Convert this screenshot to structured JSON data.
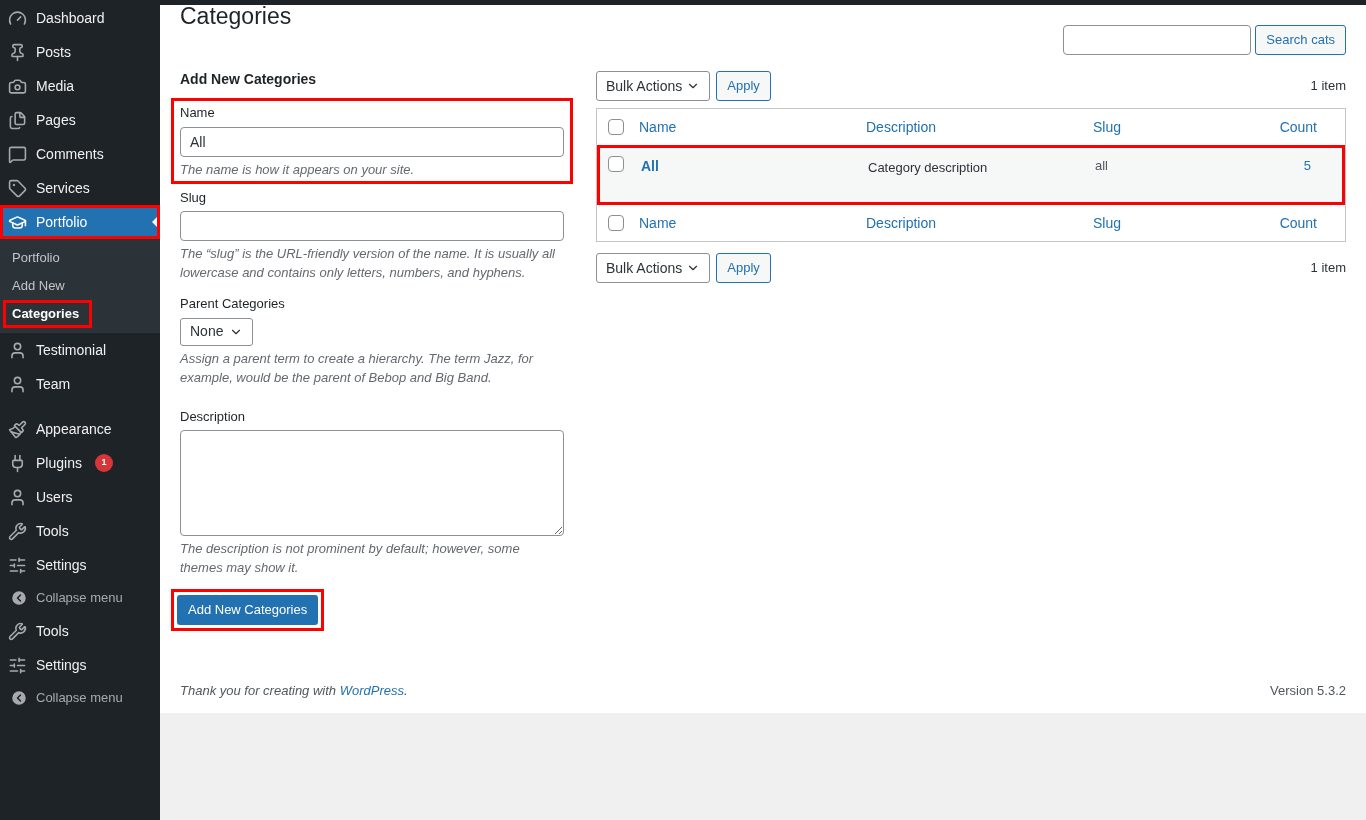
{
  "sidebar": {
    "items": [
      {
        "label": "Dashboard",
        "kind": "menu",
        "selected": false,
        "highlighted": false
      },
      {
        "label": "Posts",
        "kind": "menu",
        "selected": false,
        "highlighted": false
      },
      {
        "label": "Media",
        "kind": "menu",
        "selected": false,
        "highlighted": false
      },
      {
        "label": "Pages",
        "kind": "menu",
        "selected": false,
        "highlighted": false
      },
      {
        "label": "Comments",
        "kind": "menu",
        "selected": false,
        "highlighted": false
      },
      {
        "label": "Services",
        "kind": "menu",
        "selected": false,
        "highlighted": false
      },
      {
        "label": "Portfolio",
        "kind": "menu",
        "selected": true,
        "highlighted": true,
        "children": [
          {
            "label": "Portfolio",
            "selected": false,
            "highlighted": false
          },
          {
            "label": "Add New",
            "selected": false,
            "highlighted": false
          },
          {
            "label": "Categories",
            "selected": true,
            "highlighted": true
          }
        ]
      },
      {
        "label": "Testimonial",
        "kind": "menu",
        "selected": false,
        "highlighted": false
      },
      {
        "label": "Team",
        "kind": "menu",
        "selected": false,
        "highlighted": false
      },
      {
        "label": "Appearance",
        "kind": "menu",
        "selected": false,
        "highlighted": false
      },
      {
        "label": "Plugins",
        "kind": "menu",
        "selected": false,
        "highlighted": false,
        "badge": "1"
      },
      {
        "label": "Users",
        "kind": "menu",
        "selected": false,
        "highlighted": false
      },
      {
        "label": "Tools",
        "kind": "menu",
        "selected": false,
        "highlighted": false
      },
      {
        "label": "Settings",
        "kind": "menu",
        "selected": false,
        "highlighted": false
      },
      {
        "label": "Collapse menu",
        "kind": "collapse",
        "selected": false,
        "highlighted": false
      },
      {
        "label": "Tools",
        "kind": "menu",
        "selected": false,
        "highlighted": false
      },
      {
        "label": "Settings",
        "kind": "menu",
        "selected": false,
        "highlighted": false
      },
      {
        "label": "Collapse menu",
        "kind": "collapse",
        "selected": false,
        "highlighted": false
      }
    ]
  },
  "page_title": "Categories",
  "form": {
    "heading": "Add New Categories",
    "fields": [
      {
        "kind": "text",
        "label": "Name",
        "value": "All",
        "hint": "The name is how it appears on your site.",
        "highlighted": true
      },
      {
        "kind": "text",
        "label": "Slug",
        "hint": "The “slug” is the URL-friendly version of the name. It is usually all lowercase and contains only letters, numbers, and hyphens.",
        "highlighted": false
      },
      {
        "kind": "select",
        "label": "Parent Categories",
        "value": "None",
        "hint": "Assign a parent term to create a hierarchy. The term Jazz, for example, would be the parent of Bebop and Big Band.",
        "highlighted": false
      },
      {
        "kind": "textarea",
        "label": "Description",
        "hint": "The description is not prominent by default; however, some themes may show it.",
        "highlighted": false
      }
    ],
    "submit": {
      "label": "Add New Categories",
      "highlighted": true
    }
  },
  "search": {
    "button": "Search cats"
  },
  "top_nav": {
    "bulk_actions": "Bulk Actions",
    "apply": "Apply",
    "count": "1 item"
  },
  "table": {
    "header_checked": false,
    "columns": [
      "Name",
      "Description",
      "Slug",
      "Count"
    ],
    "rows": [
      {
        "checked": false,
        "highlighted": true,
        "name": "All",
        "description": "Category description",
        "slug": "all",
        "count": "5"
      }
    ],
    "footer_checked": false,
    "footer_columns": [
      "Name",
      "Description",
      "Slug",
      "Count"
    ]
  },
  "bottom_nav": {
    "bulk_actions": "Bulk Actions",
    "apply": "Apply",
    "count": "1 item"
  },
  "footer": {
    "thanks": "Thank you for creating with",
    "link": "WordPress",
    "after": ".",
    "version": "Version 5.3.2"
  }
}
